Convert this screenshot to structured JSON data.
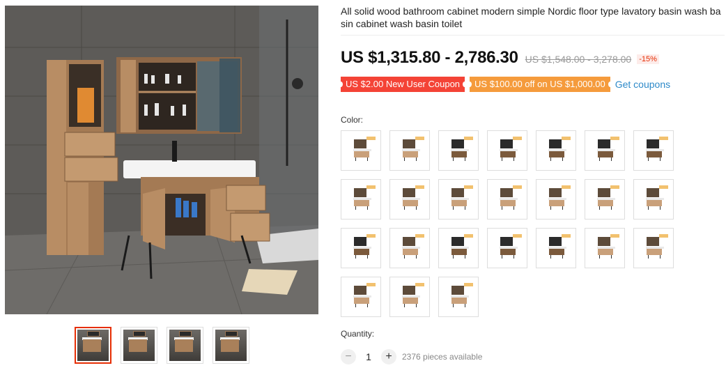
{
  "product": {
    "title": "All solid wood bathroom cabinet modern simple Nordic floor type lavatory basin wash basin cabinet wash basin toilet"
  },
  "price": {
    "current": "US $1,315.80 - 2,786.30",
    "original": "US $1,548.00 - 3,278.00",
    "discount": "-15%"
  },
  "coupons": {
    "new_user": "US $2.00 New User Coupon",
    "store": "US $100.00 off on US $1,000.00",
    "get_link": "Get coupons"
  },
  "color": {
    "label": "Color:",
    "options": [
      {
        "variant": "light"
      },
      {
        "variant": "light"
      },
      {
        "variant": "dark"
      },
      {
        "variant": "dark"
      },
      {
        "variant": "dark"
      },
      {
        "variant": "dark"
      },
      {
        "variant": "dark"
      },
      {
        "variant": "light"
      },
      {
        "variant": "light"
      },
      {
        "variant": "light"
      },
      {
        "variant": "light"
      },
      {
        "variant": "light"
      },
      {
        "variant": "light"
      },
      {
        "variant": "light"
      },
      {
        "variant": "dark"
      },
      {
        "variant": "light"
      },
      {
        "variant": "dark"
      },
      {
        "variant": "dark"
      },
      {
        "variant": "dark"
      },
      {
        "variant": "light"
      },
      {
        "variant": "light"
      },
      {
        "variant": "light"
      },
      {
        "variant": "light"
      },
      {
        "variant": "light"
      }
    ]
  },
  "quantity": {
    "label": "Quantity:",
    "value": "1",
    "minus": "−",
    "plus": "+",
    "available": "2376 pieces available"
  },
  "gallery": {
    "thumbnail_count": 4,
    "active_index": 0
  },
  "colors": {
    "price_text": "#111111",
    "coupon_red": "#f44336",
    "coupon_orange": "#f59b3c",
    "link_blue": "#2e8ac9",
    "discount_red": "#e62e04"
  }
}
